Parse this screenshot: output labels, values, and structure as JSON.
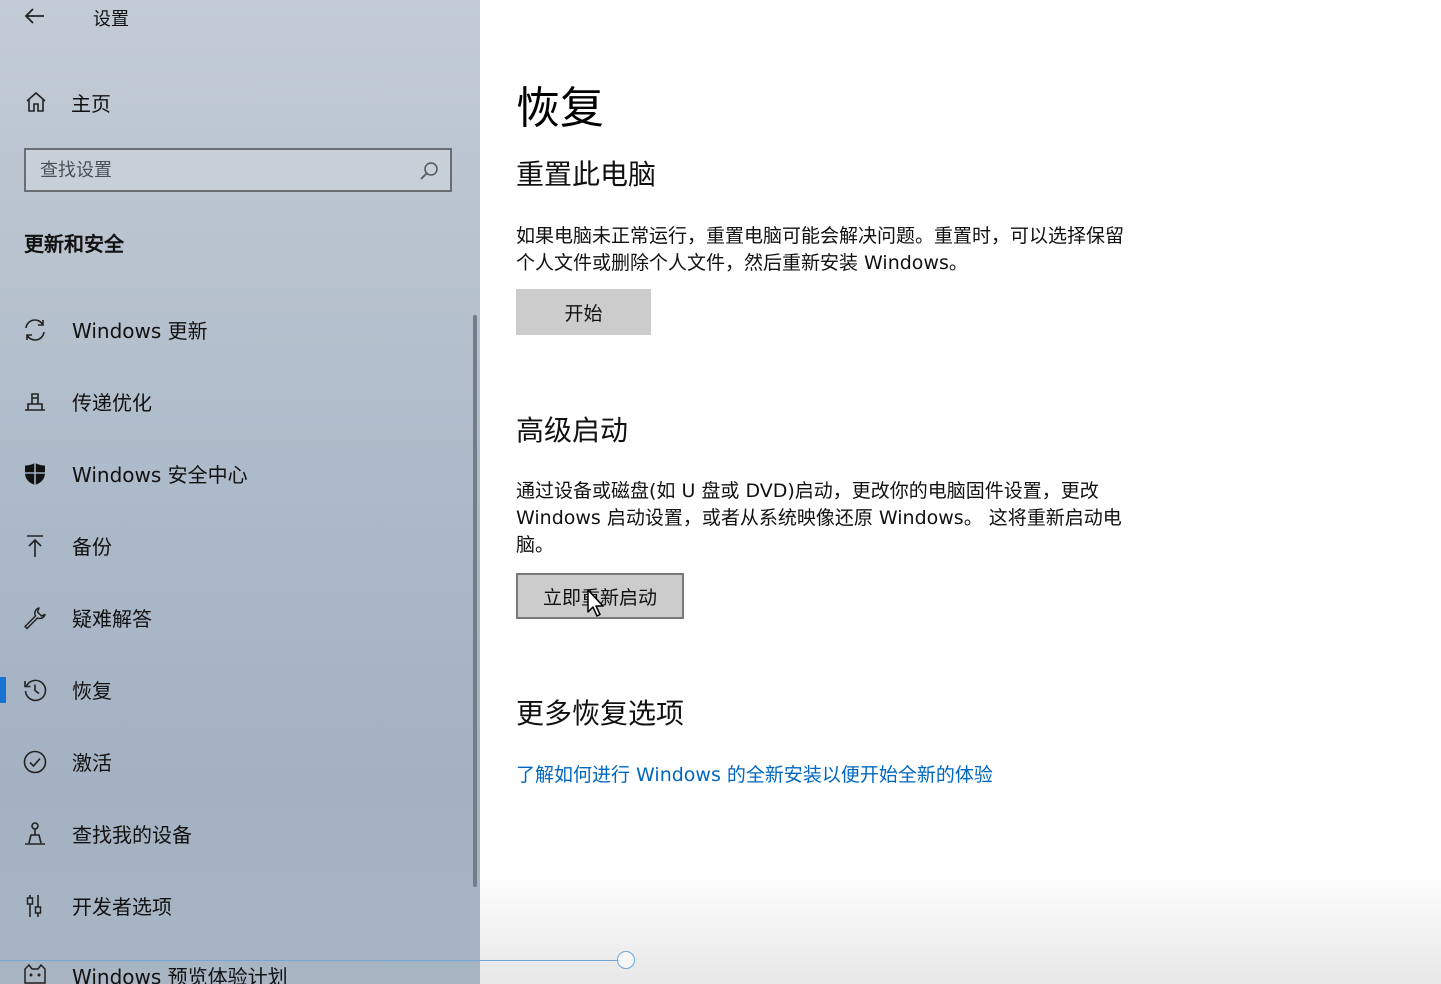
{
  "window": {
    "title": "设置"
  },
  "sidebar": {
    "home_label": "主页",
    "search_placeholder": "查找设置",
    "section_title": "更新和安全",
    "items": [
      {
        "label": "Windows 更新",
        "icon": "refresh-icon"
      },
      {
        "label": "传递优化",
        "icon": "delivery-optimization-icon"
      },
      {
        "label": "Windows 安全中心",
        "icon": "shield-icon"
      },
      {
        "label": "备份",
        "icon": "backup-arrow-icon"
      },
      {
        "label": "疑难解答",
        "icon": "wrench-icon"
      },
      {
        "label": "恢复",
        "icon": "history-icon",
        "active": true
      },
      {
        "label": "激活",
        "icon": "check-circle-icon"
      },
      {
        "label": "查找我的设备",
        "icon": "person-location-icon"
      },
      {
        "label": "开发者选项",
        "icon": "developer-sliders-icon"
      },
      {
        "label": "Windows 预览体验计划",
        "icon": "insider-cat-icon"
      }
    ]
  },
  "main": {
    "title": "恢复",
    "reset": {
      "heading": "重置此电脑",
      "description_line1": "如果电脑未正常运行，重置电脑可能会解决问题。重置时，可以选择保留",
      "description_line2": "个人文件或删除个人文件，然后重新安装 Windows。",
      "button_label": "开始"
    },
    "advanced": {
      "heading": "高级启动",
      "description_line1": "通过设备或磁盘(如 U 盘或 DVD)启动，更改你的电脑固件设置，更改",
      "description_line2": "Windows 启动设置，或者从系统映像还原 Windows。 这将重新启动电",
      "description_line3": "脑。",
      "button_label": "立即重新启动"
    },
    "more": {
      "heading": "更多恢复选项",
      "link_text": "了解如何进行 Windows 的全新安装以便开始全新的体验"
    }
  },
  "colors": {
    "accent": "#1a73d4",
    "link": "#0067c0",
    "button_bg": "#cccccc"
  }
}
